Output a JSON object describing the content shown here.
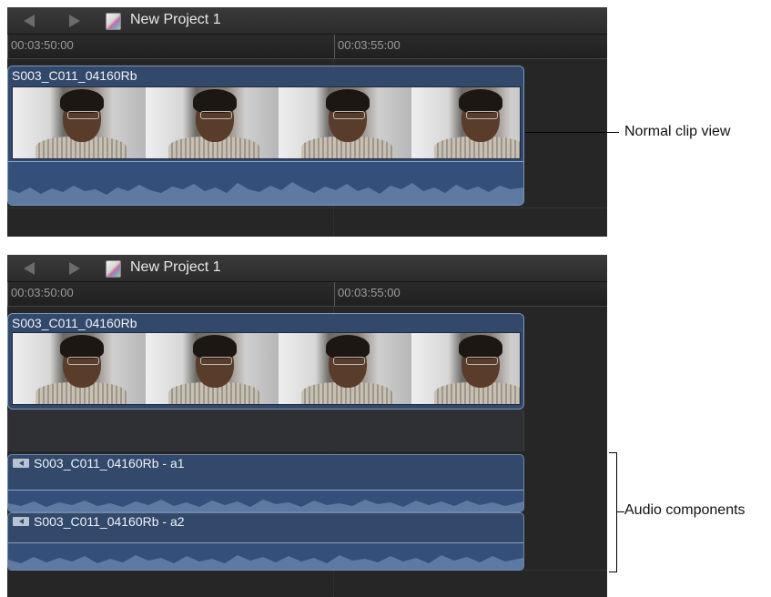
{
  "panels": [
    {
      "project_title": "New Project 1",
      "ruler": {
        "tc1": "00:03:50:00",
        "tc2": "00:03:55:00"
      },
      "clip": {
        "name": "S003_C011_04160Rb"
      }
    },
    {
      "project_title": "New Project 1",
      "ruler": {
        "tc1": "00:03:50:00",
        "tc2": "00:03:55:00"
      },
      "clip": {
        "name": "S003_C011_04160Rb"
      },
      "audio_components": [
        "S003_C011_04160Rb - a1",
        "S003_C011_04160Rb - a2"
      ]
    }
  ],
  "callouts": {
    "normal": "Normal clip view",
    "audio": "Audio components"
  },
  "icons": {
    "back": "back-arrow-icon",
    "forward": "forward-arrow-icon",
    "project": "project-icon",
    "speaker": "speaker-icon"
  }
}
